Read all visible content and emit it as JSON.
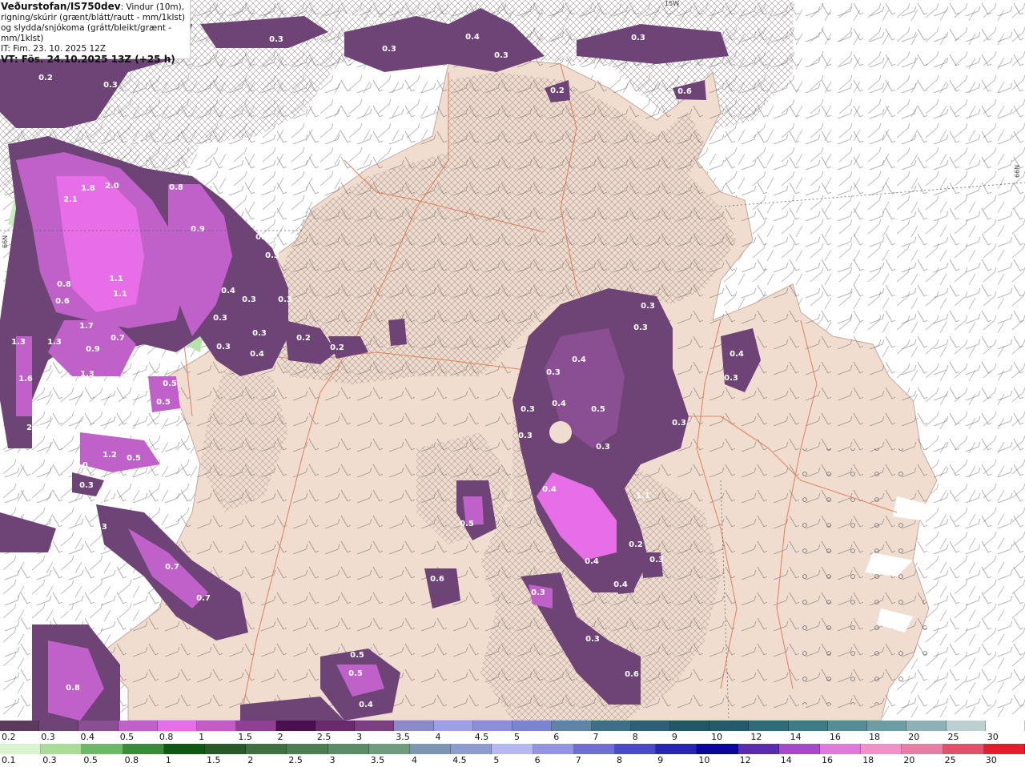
{
  "header": {
    "source": "Veðurstofan/IS750dev",
    "description": ": Vindur (10m), rigning/skúrir (grænt/blátt/rautt - mm/1klst) og slydda/snjókoma (grátt/bleikt/grænt - mm/1klst)",
    "issued": "IT: Fim. 23. 10. 2025 12Z",
    "valid": "VT: Fös. 24.10.2025 13Z (+25 h)"
  },
  "map_labels": {
    "top": "15W",
    "right": "66N",
    "left": "66N"
  },
  "precip_labels": [
    "0.2",
    "0.2",
    "0.3",
    "0.4",
    "0.3",
    "0.3",
    "0.2",
    "0.2",
    "0.3",
    "0.6",
    "0.2",
    "0.3",
    "0.4",
    "1.8",
    "2.0",
    "2.1",
    "0.8",
    "0.9",
    "1.1",
    "1.1",
    "0.3",
    "0.3",
    "0.4",
    "0.3",
    "0.3",
    "0.3",
    "0.3",
    "0.4",
    "0.3",
    "0.2",
    "0.2",
    "0.8",
    "0.6",
    "1.7",
    "1.3",
    "0.9",
    "1.3",
    "0.7",
    "1.6",
    "1.3",
    "2.3",
    "0.5",
    "0.5",
    "1.2",
    "0.5",
    "1.0",
    "0.3",
    "0.3",
    "0.3",
    "0.7",
    "0.7",
    "0.3",
    "0.8",
    "0.5",
    "0.5",
    "0.4",
    "0.3",
    "0.3",
    "0.4",
    "0.3",
    "0.3",
    "0.4",
    "0.5",
    "0.4",
    "0.3",
    "0.3",
    "0.3",
    "0.3",
    "0.4",
    "1.1",
    "0.2",
    "0.4",
    "0.4",
    "0.3",
    "0.3",
    "0.5",
    "0.3",
    "0.6",
    "0.6",
    "0.4"
  ],
  "legend_snow": {
    "labels": [
      "0.2",
      "0.3",
      "0.4",
      "0.5",
      "0.8",
      "1",
      "1.5",
      "2",
      "2.5",
      "3",
      "3.5",
      "4",
      "4.5",
      "5",
      "6",
      "7",
      "8",
      "9",
      "10",
      "12",
      "14",
      "16",
      "18",
      "20",
      "25",
      "30"
    ],
    "colors": [
      "#5b3a5e",
      "#6e4476",
      "#8a4f93",
      "#c061c9",
      "#e86ee8",
      "#c45cc6",
      "#8f3f94",
      "#4a0f4e",
      "#6a2a6e",
      "#7c4080",
      "#8b8bc7",
      "#9ea0e6",
      "#8c8fd8",
      "#7b85cf",
      "#5f84a5",
      "#3f6e8a",
      "#2e5e7a",
      "#24566a",
      "#255a6c",
      "#2f6b78",
      "#3e7b86",
      "#558c96",
      "#6d9ca5",
      "#8eb1b8",
      "#bcd0d2",
      "#ffffff"
    ]
  },
  "legend_rain": {
    "labels": [
      "0.1",
      "0.3",
      "0.5",
      "0.8",
      "1",
      "1.5",
      "2",
      "2.5",
      "3",
      "3.5",
      "4",
      "4.5",
      "5",
      "6",
      "7",
      "8",
      "9",
      "10",
      "12",
      "14",
      "16",
      "18",
      "20",
      "25",
      "30"
    ],
    "colors": [
      "#d8f5d0",
      "#a8dc98",
      "#6cb866",
      "#3a8a3a",
      "#0f5a12",
      "#285a2a",
      "#3e7040",
      "#4c7e52",
      "#5a8c66",
      "#6e9c7c",
      "#7c96b4",
      "#8c9ccc",
      "#b4b8ee",
      "#9494e0",
      "#6e6ed4",
      "#4a4ac8",
      "#2626b4",
      "#08089c",
      "#5c2cb0",
      "#a44cc8",
      "#e07ad8",
      "#ee92c8",
      "#e67ea6",
      "#e2506a",
      "#e81c2c"
    ]
  }
}
